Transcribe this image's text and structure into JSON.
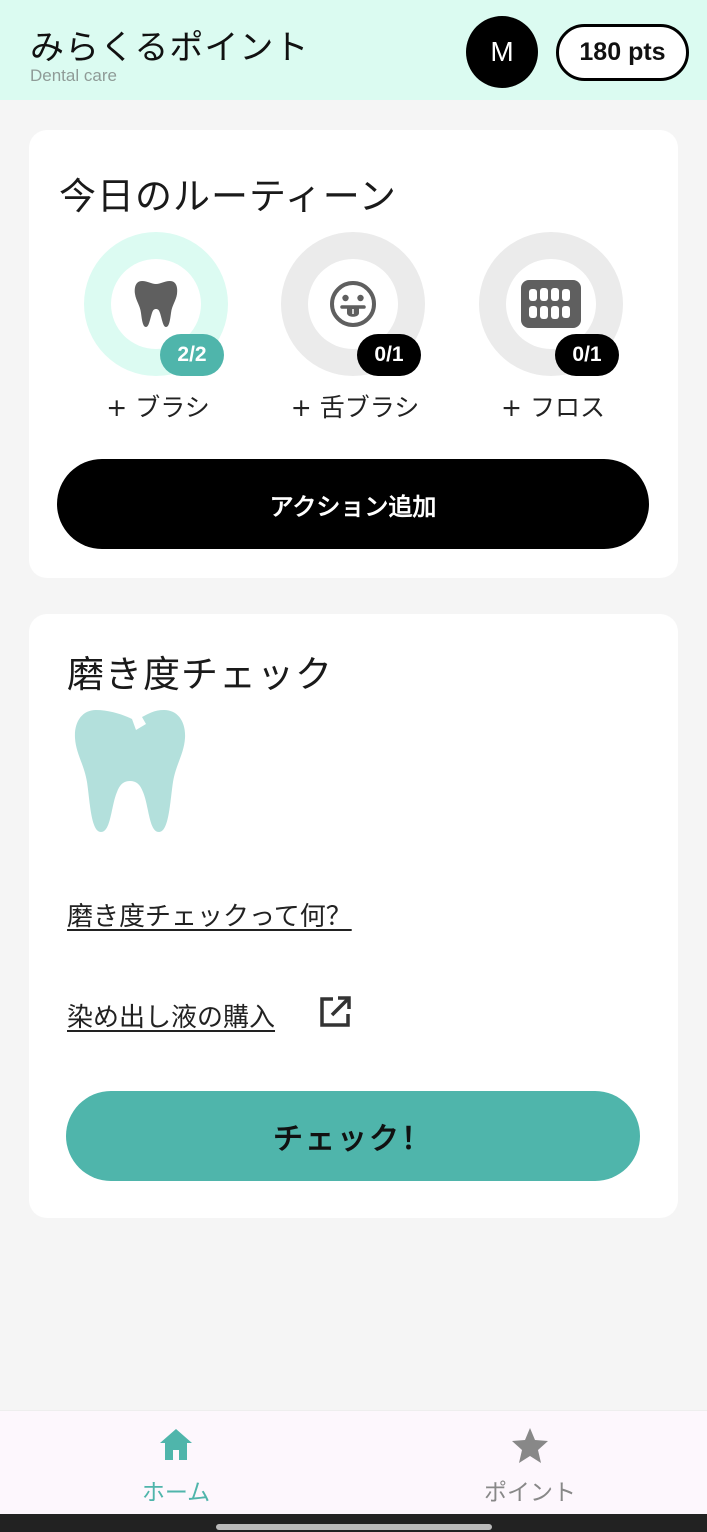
{
  "header": {
    "title": "みらくるポイント",
    "subtitle": "Dental care",
    "avatar_initial": "M",
    "points": "180 pts",
    "background_color": "#dbfbf1"
  },
  "routine": {
    "title": "今日のルーティーン",
    "items": [
      {
        "icon": "tooth-icon",
        "count": "2/2",
        "label": "+ ブラシ",
        "completed": true
      },
      {
        "icon": "tongue-face-icon",
        "count": "0/1",
        "label": "+ 舌ブラシ",
        "completed": false
      },
      {
        "icon": "dentures-icon",
        "count": "0/1",
        "label": "+ フロス",
        "completed": false
      }
    ],
    "add_action_label": "アクション追加"
  },
  "check": {
    "title": "磨き度チェック",
    "illustration": "tooth-illustration",
    "what_link": "磨き度チェックって何？",
    "buy_link": "染め出し液の購入",
    "buy_link_icon": "external-link-icon",
    "button_label": "チェック！"
  },
  "bottom_nav": {
    "items": [
      {
        "icon": "home-icon",
        "label": "ホーム",
        "active": true
      },
      {
        "icon": "star-icon",
        "label": "ポイント",
        "active": false
      }
    ]
  },
  "colors": {
    "accent": "#4fb5ab",
    "accent_light": "#dcfbf2",
    "tooth_illustration": "#b3e0dc"
  }
}
